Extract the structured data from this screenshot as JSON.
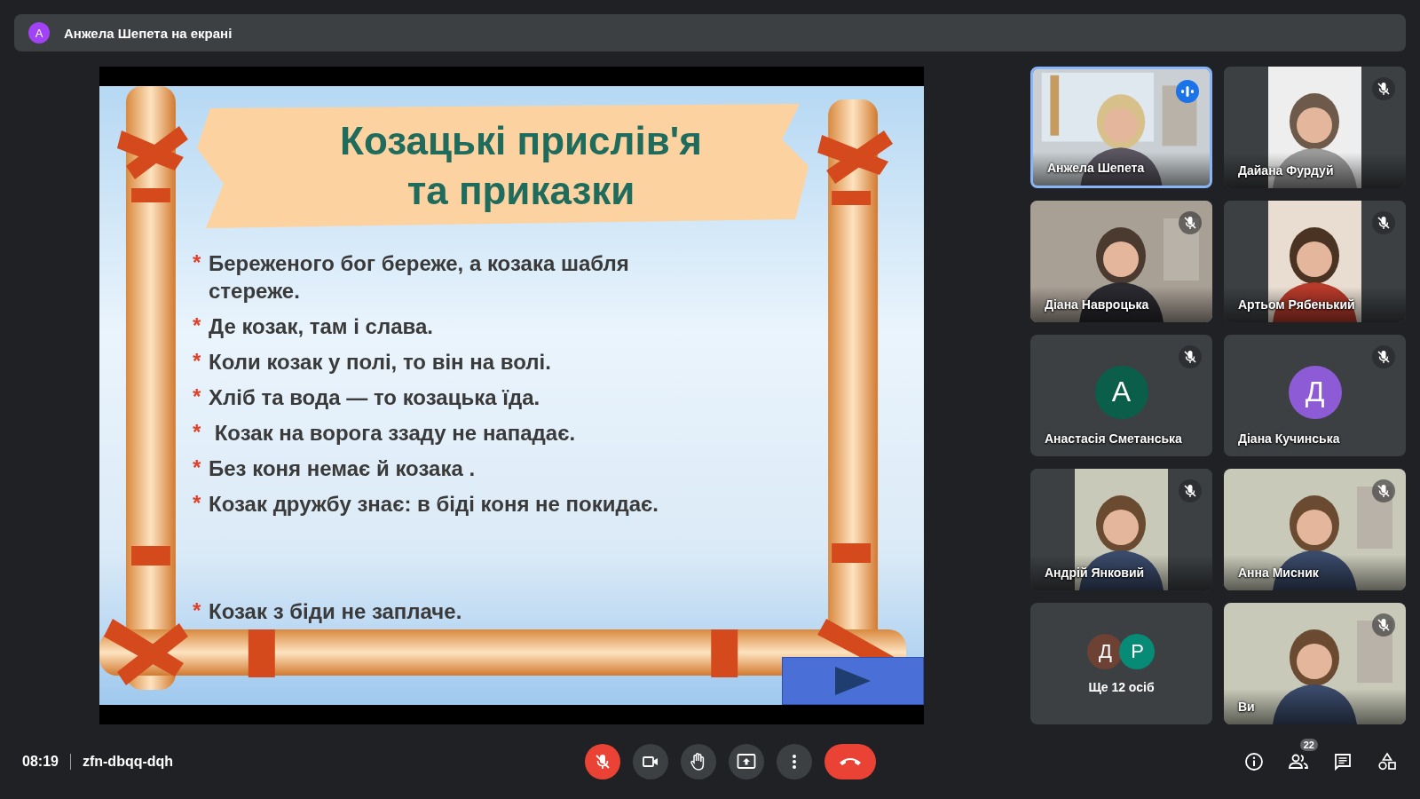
{
  "presentation_banner": {
    "avatar": "А",
    "text": "Анжела Шепета на екрані"
  },
  "slide": {
    "title_lines": [
      "Козацькі прислів'я",
      "та приказки"
    ],
    "items": [
      {
        "marker": "*",
        "text": "Береженого бог береже, а козака шабля стереже."
      },
      {
        "marker": "*",
        "text": "Де козак, там і слава."
      },
      {
        "marker": "*",
        "text": "Коли козак у полі, то він на волі."
      },
      {
        "marker": "*",
        "text": "Хліб та вода — то козацька їда."
      },
      {
        "marker": "*",
        "text": " Козак на ворога ззаду не нападає."
      },
      {
        "marker": "*",
        "text": "Без коня немає й козака ."
      },
      {
        "marker": "*",
        "text": "Козак дружбу знає: в біді коня не покидає."
      }
    ],
    "closing_item": {
      "marker": "*",
      "text": "Козак з біди не заплаче."
    }
  },
  "tiles": [
    {
      "kind": "video",
      "name": "Анжела Шепета",
      "speaking": true
    },
    {
      "kind": "video",
      "name": "Дайана Фурдуй",
      "speaking": false,
      "muted": true
    },
    {
      "kind": "video",
      "name": "Діана Навроцька",
      "speaking": false,
      "muted": true
    },
    {
      "kind": "video",
      "name": "Артьом Рябенький",
      "speaking": false,
      "muted": true
    },
    {
      "kind": "avatar",
      "initial": "А",
      "color": "#0b5e4a",
      "name": "Анастасія Сметанська",
      "speaking": false,
      "muted": true
    },
    {
      "kind": "avatar",
      "initial": "Д",
      "color": "#8e5bd6",
      "name": "Діана Кучинська",
      "speaking": false,
      "muted": true
    },
    {
      "kind": "video",
      "name": "Андрій Янковий",
      "speaking": false,
      "muted": true
    },
    {
      "kind": "video",
      "name": "Анна Мисник",
      "speaking": false,
      "muted": true
    },
    {
      "kind": "overflow",
      "avatars": [
        {
          "initial": "Д",
          "color": "#6d4235"
        },
        {
          "initial": "Р",
          "color": "#078a76"
        }
      ],
      "label": "Ще 12 осіб"
    },
    {
      "kind": "video",
      "name": "Ви",
      "speaking": false,
      "muted": true
    }
  ],
  "meeting": {
    "time": "08:19",
    "code": "zfn-dbqq-dqh"
  },
  "controls": [
    {
      "kind": "mic",
      "on": false
    },
    {
      "kind": "camera",
      "on": true
    },
    {
      "kind": "hand"
    },
    {
      "kind": "present"
    },
    {
      "kind": "more"
    },
    {
      "kind": "leave"
    }
  ],
  "side_controls": [
    {
      "kind": "info"
    },
    {
      "kind": "people",
      "badge": "22"
    },
    {
      "kind": "chat"
    },
    {
      "kind": "activities"
    }
  ]
}
